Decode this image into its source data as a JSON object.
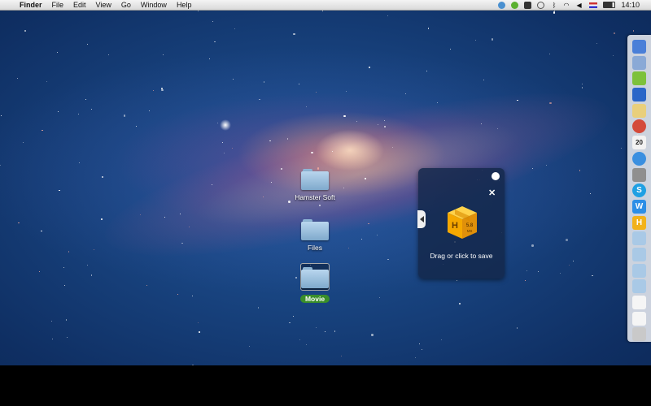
{
  "menubar": {
    "apple_symbol": "",
    "app_name": "Finder",
    "menus": [
      "File",
      "Edit",
      "View",
      "Go",
      "Window",
      "Help"
    ],
    "clock": "14:10",
    "status_icons": [
      "sync-icon",
      "checkmark-icon",
      "bat-icon",
      "time-machine-icon",
      "bluetooth-icon",
      "wifi-icon",
      "volume-icon",
      "flag-icon",
      "battery-icon"
    ]
  },
  "desktop": {
    "items": [
      {
        "label": "Hamster Soft",
        "selected": false
      },
      {
        "label": "Files",
        "selected": false
      },
      {
        "label": "Movie",
        "selected": true
      }
    ]
  },
  "save_widget": {
    "box_letter": "H",
    "box_size": "5.8",
    "box_unit": "MB",
    "close_symbol": "✕",
    "caption": "Drag or click to save"
  },
  "dock": {
    "items": [
      {
        "name": "finder-icon",
        "color": "#4a7fd8",
        "glyph": ""
      },
      {
        "name": "preview-icon",
        "color": "#8aa9d6",
        "glyph": ""
      },
      {
        "name": "android-icon",
        "color": "#7dc13a",
        "glyph": ""
      },
      {
        "name": "video-call-icon",
        "color": "#2a66c8",
        "glyph": ""
      },
      {
        "name": "notes-icon",
        "color": "#e9cf7b",
        "glyph": ""
      },
      {
        "name": "chrome-icon",
        "color": "#d44a3a",
        "glyph": ""
      },
      {
        "name": "calendar-icon",
        "color": "#f2f2f2",
        "glyph": "20"
      },
      {
        "name": "itunes-icon",
        "color": "#3a8fe0",
        "glyph": ""
      },
      {
        "name": "system-preferences-icon",
        "color": "#8f8f8f",
        "glyph": ""
      },
      {
        "name": "skype-icon",
        "color": "#1fa0e3",
        "glyph": "S"
      },
      {
        "name": "word-icon",
        "color": "#2c8ee6",
        "glyph": "W"
      },
      {
        "name": "hamster-icon",
        "color": "#f2b21a",
        "glyph": "H"
      },
      {
        "name": "folder-icon",
        "color": "#a9c9e6",
        "glyph": ""
      },
      {
        "name": "folder-icon-2",
        "color": "#a9c9e6",
        "glyph": ""
      },
      {
        "name": "folder-icon-3",
        "color": "#a9c9e6",
        "glyph": ""
      },
      {
        "name": "folder-icon-4",
        "color": "#a9c9e6",
        "glyph": ""
      },
      {
        "name": "document-icon",
        "color": "#f5f5f5",
        "glyph": ""
      },
      {
        "name": "document-icon-2",
        "color": "#f5f5f5",
        "glyph": ""
      },
      {
        "name": "trash-icon",
        "color": "#c9c9c9",
        "glyph": ""
      }
    ]
  }
}
